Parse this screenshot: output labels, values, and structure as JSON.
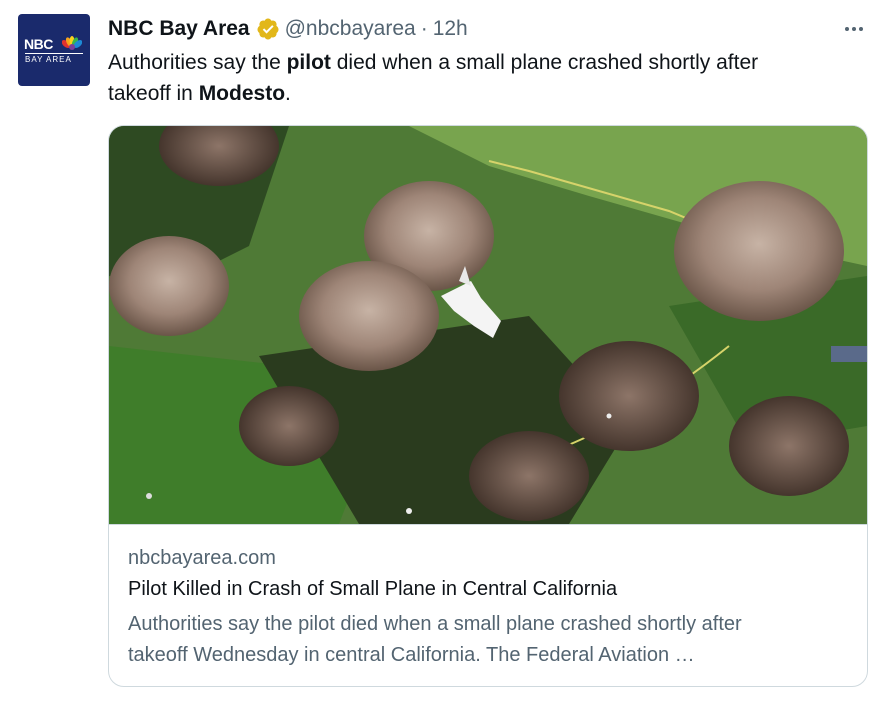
{
  "tweet": {
    "display_name": "NBC Bay Area",
    "handle": "@nbcbayarea",
    "separator": "·",
    "time": "12h",
    "text_line1_pre": "Authorities say the ",
    "text_line1_bold": "pilot",
    "text_line1_post": " died when a small plane crashed shortly after",
    "text_line2_pre": "takeoff in ",
    "text_line2_bold": "Modesto",
    "text_line2_post": "."
  },
  "avatar": {
    "logo_main": "NBC",
    "logo_sub": "BAY AREA"
  },
  "card": {
    "domain": "nbcbayarea.com",
    "title": "Pilot Killed in Crash of Small Plane in Central California",
    "description_line1": "Authorities say the pilot died when a small plane crashed shortly after",
    "description_line2": "takeoff Wednesday in central California. The Federal Aviation …"
  },
  "icons": {
    "verified": "verified-badge-icon",
    "more": "more-options-icon",
    "peacock": "peacock-icon"
  },
  "colors": {
    "text_primary": "#0f1419",
    "text_secondary": "#536471",
    "verified_gold": "#e2b719",
    "border": "#cfd9de",
    "avatar_bg": "#1a2a6c"
  }
}
